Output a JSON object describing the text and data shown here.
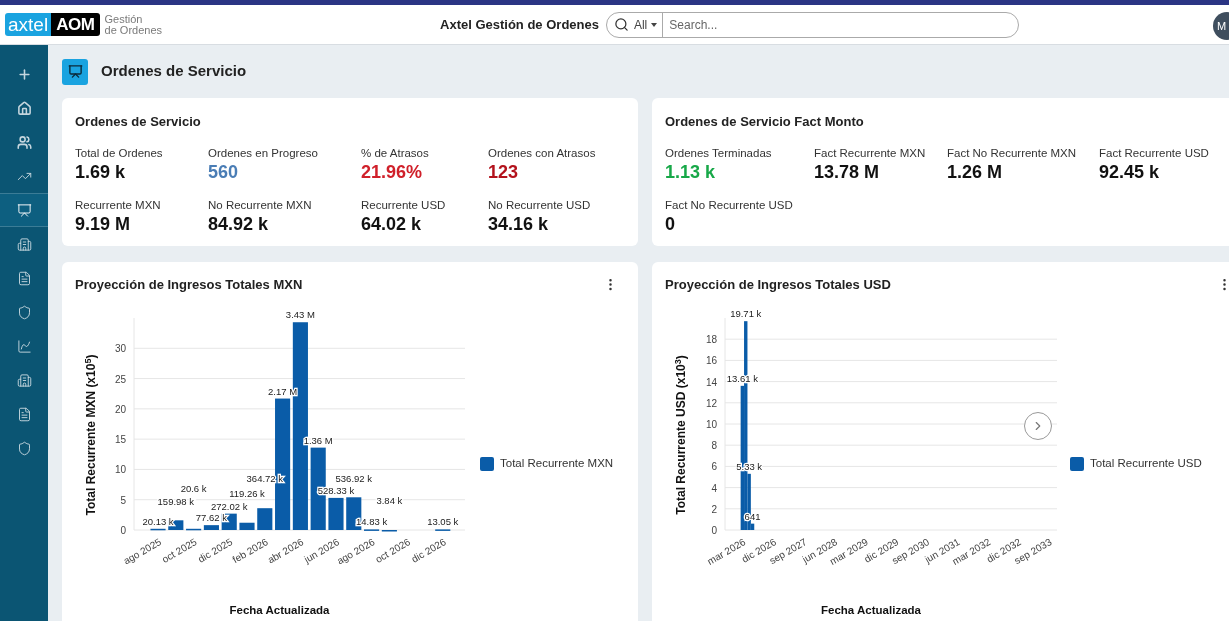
{
  "header": {
    "logo": {
      "brand": "axtel",
      "product": "AOM",
      "subtitle_1": "Gestión",
      "subtitle_2": "de Ordenes"
    },
    "app_title": "Axtel Gestión de Ordenes",
    "search": {
      "scope": "All",
      "placeholder": "Search..."
    },
    "avatar": "M"
  },
  "sidebar": {
    "items": [
      {
        "selected": false
      },
      {
        "selected": false
      },
      {
        "selected": false
      },
      {
        "selected": false
      },
      {
        "selected": true
      },
      {
        "selected": false
      },
      {
        "selected": false
      },
      {
        "selected": false
      },
      {
        "selected": false
      },
      {
        "selected": false
      },
      {
        "selected": false
      },
      {
        "selected": false
      }
    ]
  },
  "page": {
    "title": "Ordenes de Servicio"
  },
  "summary_cards": [
    {
      "title": "Ordenes de Servicio",
      "metrics": [
        {
          "label": "Total de Ordenes",
          "value": "1.69 k"
        },
        {
          "label": "Ordenes en Progreso",
          "value": "560",
          "color": "#4a7db5"
        },
        {
          "label": "% de Atrasos",
          "value": "21.96%",
          "color": "#d0202a"
        },
        {
          "label": "Ordenes con Atrasos",
          "value": "123",
          "color": "#b3121c"
        },
        {
          "label": "Recurrente MXN",
          "value": "9.19 M"
        },
        {
          "label": "No Recurrente MXN",
          "value": "84.92 k"
        },
        {
          "label": "Recurrente USD",
          "value": "64.02 k"
        },
        {
          "label": "No Recurrente USD",
          "value": "34.16 k"
        }
      ]
    },
    {
      "title": "Ordenes de Servicio Fact Monto",
      "metrics": [
        {
          "label": "Ordenes Terminadas",
          "value": "1.13 k",
          "color": "#17a848"
        },
        {
          "label": "Fact Recurrente MXN",
          "value": "13.78 M"
        },
        {
          "label": "Fact No Recurrente MXN",
          "value": "1.26 M"
        },
        {
          "label": "Fact Recurrente USD",
          "value": "92.45 k"
        },
        {
          "label": "Fact No Recurrente USD",
          "value": "0"
        }
      ]
    }
  ],
  "charts": [
    {
      "title": "Proyección de Ingresos Totales MXN",
      "has_next_button": false,
      "chart_data": {
        "type": "bar",
        "xlabel": "Fecha Actualizada",
        "ylabel": "Total Recurrente MXN (x10$^{5}$)",
        "grid": true,
        "ylim": [
          0,
          35
        ],
        "yticks": [
          0,
          5,
          10,
          15,
          20,
          25,
          30
        ],
        "categories": [
          "ago 2025",
          null,
          "oct 2025",
          null,
          "dic 2025",
          null,
          "feb 2026",
          null,
          "abr 2026",
          null,
          "jun 2026",
          null,
          "ago 2026",
          null,
          "oct 2026",
          null,
          "dic 2026"
        ],
        "series": [
          {
            "name": "Total Recurrente MXN",
            "color": "#0a5ca8",
            "values": [
              0.2,
              1.6,
              0.2,
              0.8,
              2.7,
              1.2,
              3.6,
              21.7,
              34.3,
              13.6,
              5.3,
              5.4,
              0.1,
              0.0,
              null,
              null,
              0.1
            ]
          }
        ],
        "value_labels": [
          "20.13 k",
          "159.98 k",
          "20.6 k",
          "77.62 k",
          "272.02 k",
          "119.26 k",
          "364.72 k",
          "2.17 M",
          "3.43 M",
          "1.36 M",
          "528.33 k",
          "536.92 k",
          "14.83 k",
          "3.84 k",
          null,
          null,
          "13.05 k"
        ]
      }
    },
    {
      "title": "Proyección de Ingresos Totales USD",
      "has_next_button": true,
      "chart_data": {
        "type": "bar",
        "xlabel": "Fecha Actualizada",
        "ylabel": "Total Recurrente USD (x10$^{3}$)",
        "grid": true,
        "ylim": [
          0,
          20
        ],
        "yticks": [
          0,
          2,
          4,
          6,
          8,
          10,
          12,
          14,
          16,
          18
        ],
        "categories": [
          "mar 2026",
          null,
          null,
          null,
          null,
          null,
          null,
          null,
          null,
          "dic 2026",
          null,
          null,
          null,
          null,
          null,
          null,
          null,
          null,
          "sep 2027",
          null,
          null,
          null,
          null,
          null,
          null,
          null,
          null,
          "jun 2028",
          null,
          null,
          null,
          null,
          null,
          null,
          null,
          null,
          "mar 2029",
          null,
          null,
          null,
          null,
          null,
          null,
          null,
          null,
          "dic 2029",
          null,
          null,
          null,
          null,
          null,
          null,
          null,
          null,
          "sep 2030",
          null,
          null,
          null,
          null,
          null,
          null,
          null,
          null,
          "jun 2031",
          null,
          null,
          null,
          null,
          null,
          null,
          null,
          null,
          "mar 2032",
          null,
          null,
          null,
          null,
          null,
          null,
          null,
          null,
          "dic 2032",
          null,
          null,
          null,
          null,
          null,
          null,
          null,
          null,
          "sep 2033"
        ],
        "series": [
          {
            "name": "Total Recurrente USD",
            "color": "#0a5ca8",
            "values": [
              13.6,
              19.7,
              5.3,
              0.6,
              null,
              null,
              null,
              null,
              null,
              null,
              null,
              null,
              null,
              null,
              null,
              null,
              null,
              null,
              null,
              null,
              null,
              null,
              null,
              null,
              null,
              null,
              null,
              null,
              null,
              null,
              null,
              null,
              null,
              null,
              null,
              null,
              null,
              null,
              null,
              null,
              null,
              null,
              null,
              null,
              null,
              null,
              null,
              null,
              null,
              null,
              null,
              null,
              null,
              null,
              null,
              null,
              null,
              null,
              null,
              null,
              null,
              null,
              null,
              null,
              null,
              null,
              null,
              null,
              null,
              null,
              null,
              null,
              null,
              null,
              null,
              null,
              null,
              null,
              null,
              null,
              null,
              null,
              null,
              null,
              null,
              null,
              null,
              null,
              null,
              null,
              null
            ]
          }
        ],
        "value_labels": [
          "13.61 k",
          "19.71 k",
          "5.33 k",
          "641",
          null,
          null,
          null,
          null,
          null,
          null,
          null,
          null,
          null,
          null,
          null,
          null,
          null,
          null,
          null,
          null,
          null,
          null,
          null,
          null,
          null,
          null,
          null,
          null,
          null,
          null,
          null,
          null,
          null,
          null,
          null,
          null,
          null,
          null,
          null,
          null,
          null,
          null,
          null,
          null,
          null,
          null,
          null,
          null,
          null,
          null,
          null,
          null,
          null,
          null,
          null,
          null,
          null,
          null,
          null,
          null,
          null,
          null,
          null,
          null,
          null,
          null,
          null,
          null,
          null,
          null,
          null,
          null,
          null,
          null,
          null,
          null,
          null,
          null,
          null,
          null,
          null,
          null,
          null,
          null,
          null,
          null,
          null,
          null,
          null,
          null,
          null
        ]
      }
    }
  ]
}
